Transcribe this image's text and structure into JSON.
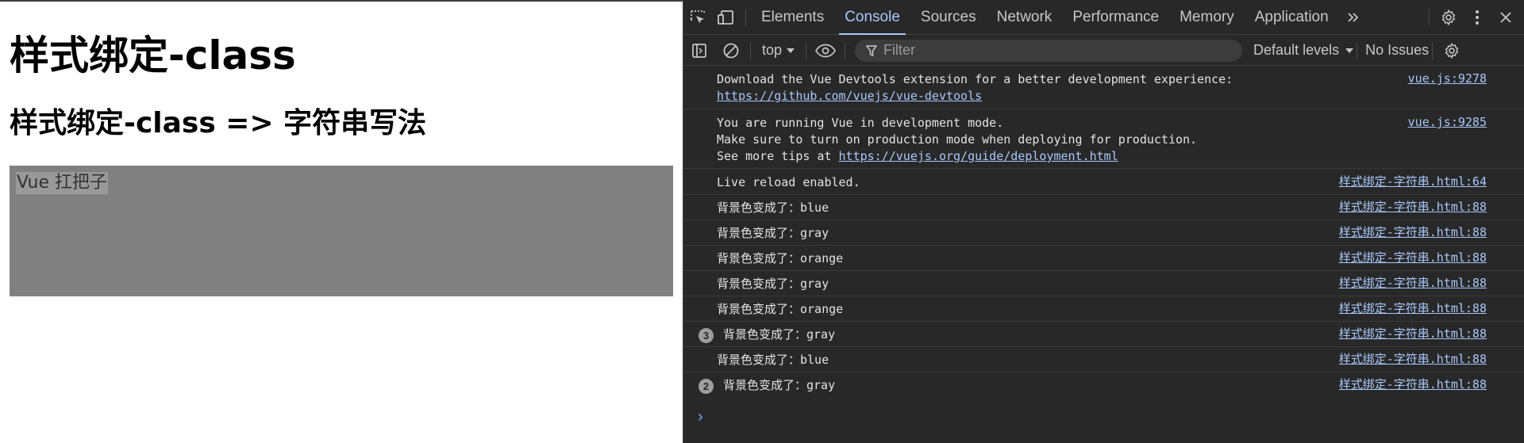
{
  "page": {
    "h1": "样式绑定-class",
    "h2": "样式绑定-class => 字符串写法",
    "box_text": "Vue 扛把子",
    "box_color": "#808080"
  },
  "devtools": {
    "tabs": [
      "Elements",
      "Console",
      "Sources",
      "Network",
      "Performance",
      "Memory",
      "Application"
    ],
    "active_tab": "Console",
    "toolbar": {
      "context": "top",
      "filter_placeholder": "Filter",
      "levels": "Default levels",
      "issues": "No Issues"
    },
    "messages": [
      {
        "lines": [
          "Download the Vue Devtools extension for a better development experience:"
        ],
        "link": "https://github.com/vuejs/vue-devtools",
        "source": "vue.js:9278"
      },
      {
        "lines": [
          "You are running Vue in development mode.",
          "Make sure to turn on production mode when deploying for production."
        ],
        "link_prefix": "See more tips at ",
        "link": "https://vuejs.org/guide/deployment.html",
        "source": "vue.js:9285"
      },
      {
        "text": "Live reload enabled.",
        "source": "样式绑定-字符串.html:64"
      },
      {
        "text": "背景色变成了：blue",
        "source": "样式绑定-字符串.html:88"
      },
      {
        "text": "背景色变成了：gray",
        "source": "样式绑定-字符串.html:88"
      },
      {
        "text": "背景色变成了：orange",
        "source": "样式绑定-字符串.html:88"
      },
      {
        "text": "背景色变成了：gray",
        "source": "样式绑定-字符串.html:88"
      },
      {
        "text": "背景色变成了：orange",
        "source": "样式绑定-字符串.html:88"
      },
      {
        "text": "背景色变成了：gray",
        "source": "样式绑定-字符串.html:88",
        "count": "3"
      },
      {
        "text": "背景色变成了：blue",
        "source": "样式绑定-字符串.html:88"
      },
      {
        "text": "背景色变成了：gray",
        "source": "样式绑定-字符串.html:88",
        "count": "2"
      }
    ],
    "prompt": "›"
  },
  "icons": [
    "inspect-element-icon",
    "device-toolbar-icon",
    "more-tabs-icon",
    "settings-icon",
    "more-options-icon",
    "close-icon",
    "sidebar-toggle-icon",
    "clear-console-icon",
    "live-expression-icon",
    "filter-icon",
    "console-settings-icon"
  ],
  "colors": {
    "accent": "#a8c7fa",
    "panel_bg": "#282828",
    "box_bg": "#808080"
  }
}
